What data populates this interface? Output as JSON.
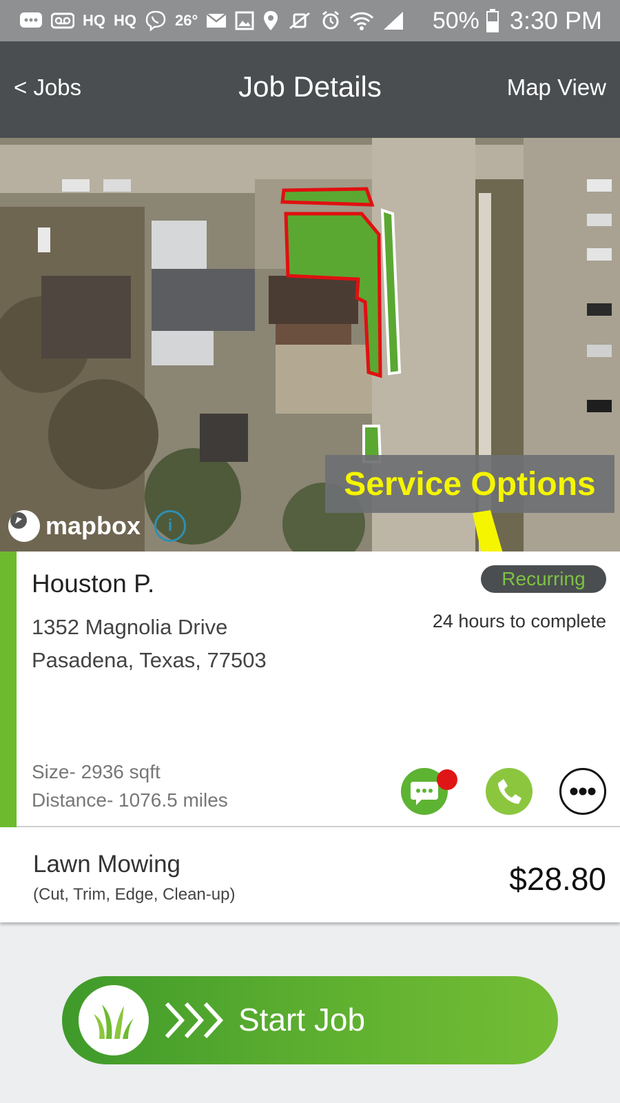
{
  "status_bar": {
    "temperature": "26°",
    "battery": "50%",
    "time": "3:30 PM",
    "hq_labels": [
      "HQ",
      "HQ"
    ],
    "icons": [
      "messages-icon",
      "voicemail-icon",
      "hq-icon",
      "hq-icon",
      "viber-icon",
      "temperature",
      "mail-icon",
      "gallery-icon",
      "location-icon",
      "mute-icon",
      "alarm-icon",
      "wifi-icon",
      "signal-icon",
      "battery-icon"
    ]
  },
  "nav": {
    "back_label": "< Jobs",
    "title": "Job Details",
    "map_view_label": "Map View"
  },
  "map": {
    "attribution": "mapbox",
    "info_label": "i"
  },
  "annotation": {
    "label": "Service Options",
    "color": "#f5f500"
  },
  "job": {
    "client_name": "Houston P.",
    "address_line1": "1352 Magnolia Drive",
    "address_line2": "Pasadena, Texas, 77503",
    "badge": "Recurring",
    "deadline": "24 hours to complete",
    "size": "Size- 2936 sqft",
    "distance": "Distance- 1076.5 miles",
    "actions": [
      "message-icon",
      "phone-icon",
      "more-options-icon"
    ]
  },
  "service": {
    "name": "Lawn Mowing",
    "description": "(Cut, Trim, Edge, Clean-up)",
    "price": "$28.80"
  },
  "start_button": {
    "label": "Start Job"
  },
  "colors": {
    "brand_green": "#6dba2f",
    "nav_bg": "#4a4e50",
    "status_bg": "#8e9092",
    "notification_red": "#e01616",
    "lawn_outline_red": "#e01010"
  }
}
